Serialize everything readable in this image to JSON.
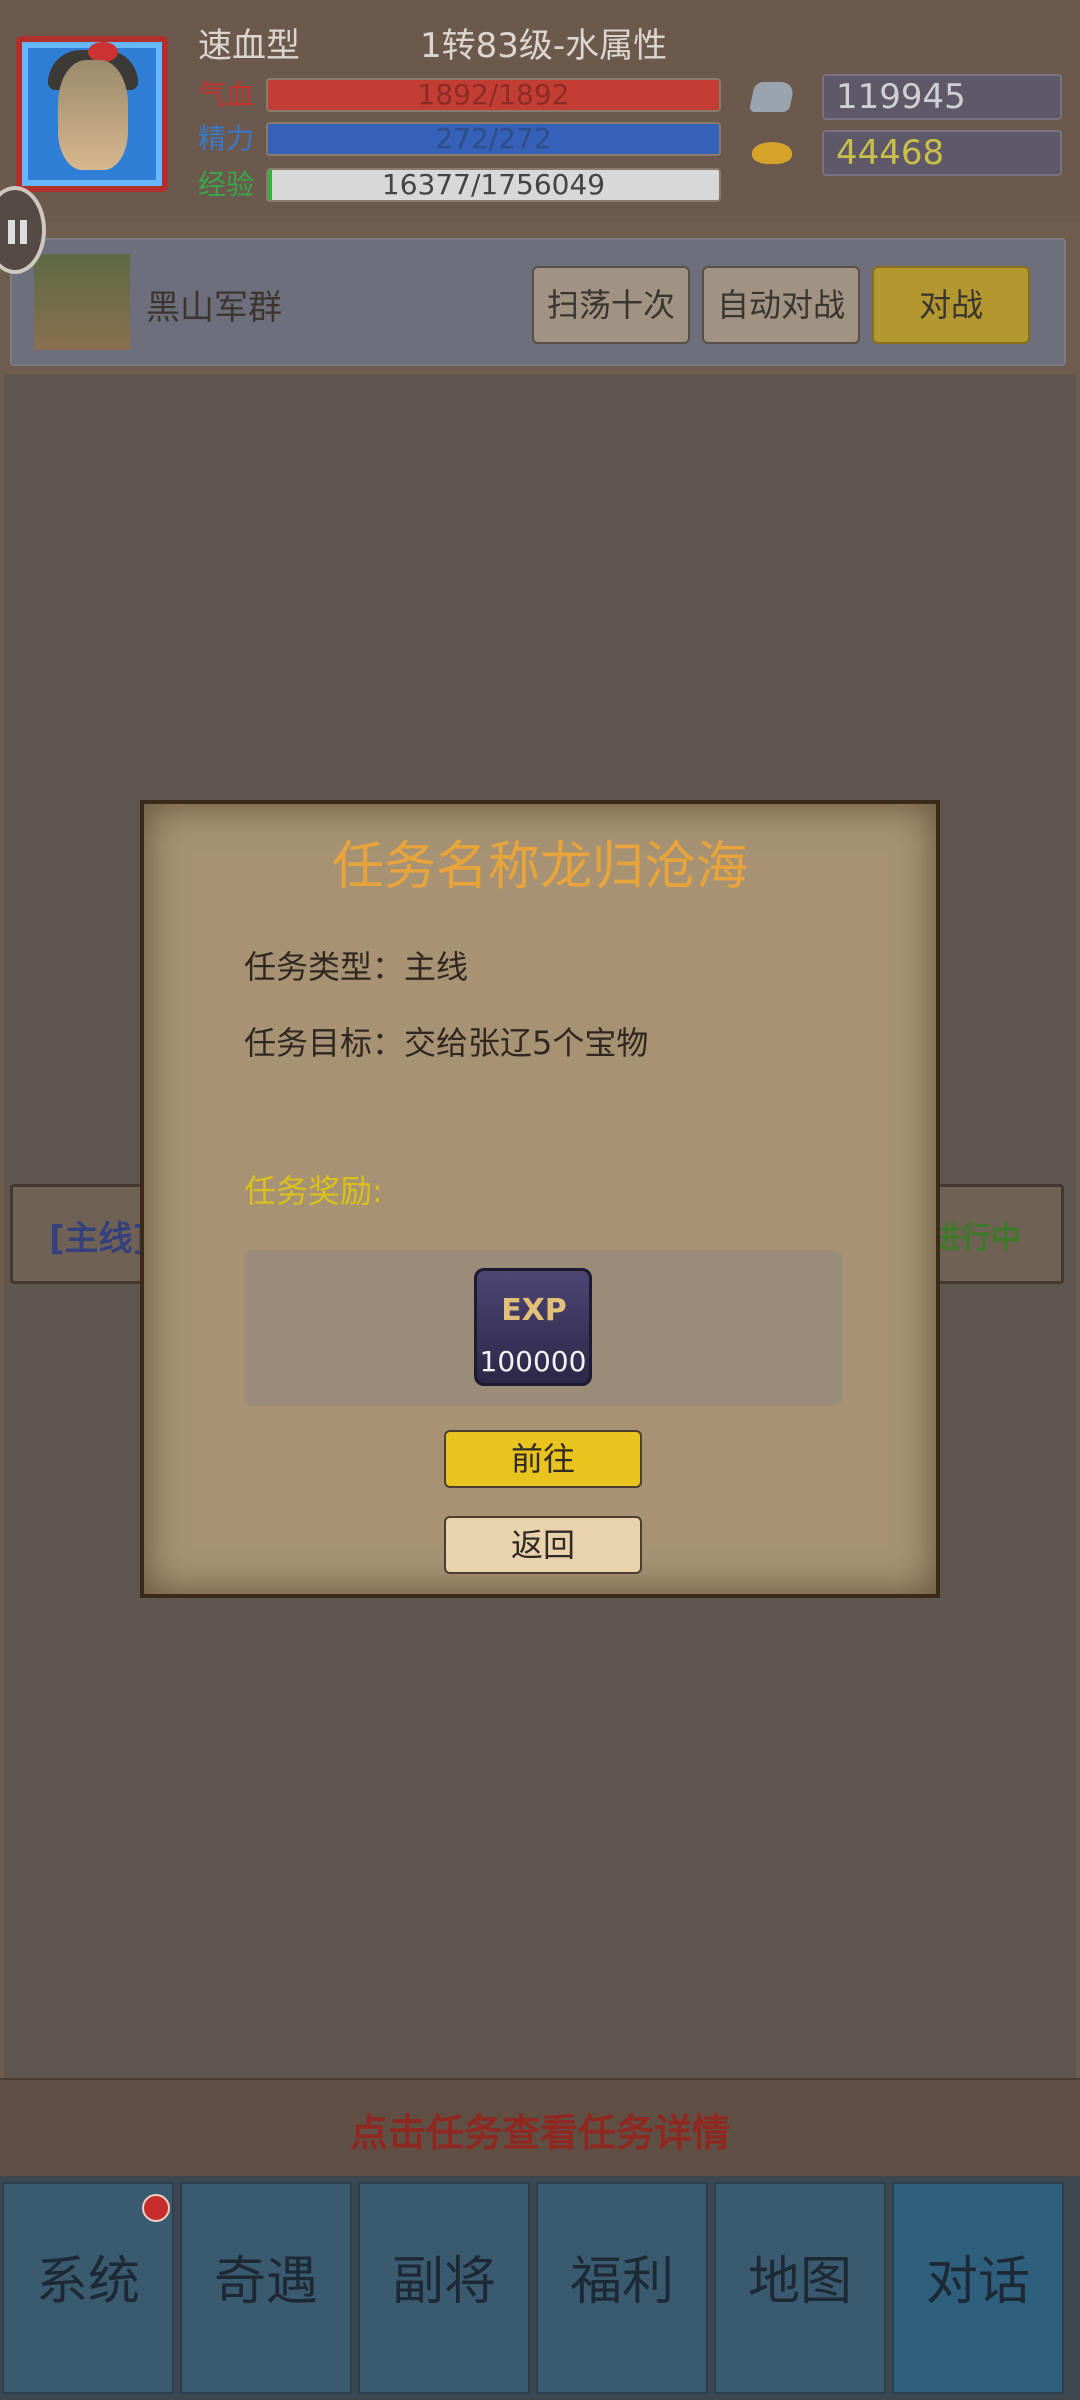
{
  "header": {
    "type": "速血型",
    "level": "1转83级-水属性",
    "hp": {
      "label": "气血",
      "value": "1892/1892",
      "fill": 1.0
    },
    "mp": {
      "label": "精力",
      "value": "272/272",
      "fill": 1.0
    },
    "exp": {
      "label": "经验",
      "value": "16377/1756049",
      "fill": 0.0093
    },
    "silver": "119945",
    "gold": "44468"
  },
  "enemy": {
    "name": "黑山军群",
    "sweep_label": "扫荡十次",
    "auto_label": "自动对战",
    "fight_label": "对战"
  },
  "task_row": {
    "tag": "[主线]",
    "status": "进行中"
  },
  "hint": "点击任务查看任务详情",
  "nav": {
    "items": [
      "系统",
      "奇遇",
      "副将",
      "福利",
      "地图",
      "对话"
    ]
  },
  "modal": {
    "title": "任务名称龙归沧海",
    "type_line": "任务类型：主线",
    "goal_line": "任务目标：交给张辽5个宝物",
    "reward_label": "任务奖励:",
    "reward_icon_text": "EXP",
    "reward_amount": "100000",
    "go_label": "前往",
    "back_label": "返回"
  },
  "colors": {
    "accent_gold": "#e9c41e",
    "title_orange": "#e8a43a",
    "hp_red": "#c23d33",
    "mp_blue": "#3561b8",
    "exp_green": "#38b03c"
  }
}
